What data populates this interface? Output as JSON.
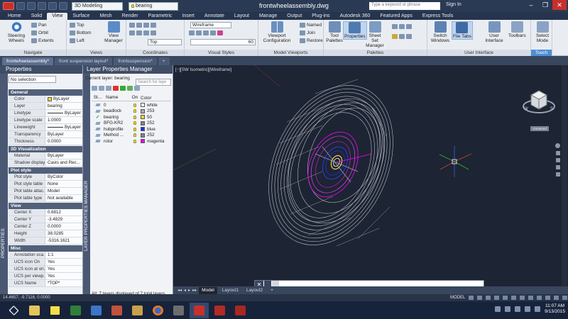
{
  "titlebar": {
    "workspace": "3D Modeling",
    "layer_current": "bearing",
    "document_title": "frontwheelassembly.dwg",
    "search_placeholder": "Type a keyword or phrase",
    "signin": "Sign In"
  },
  "ribbon_tabs": [
    "Home",
    "Solid",
    "View",
    "Surface",
    "Mesh",
    "Render",
    "Parametric",
    "Insert",
    "Annotate",
    "Layout",
    "Manage",
    "Output",
    "Plug-ins",
    "Autodesk 360",
    "Featured Apps",
    "Express Tools"
  ],
  "ribbon_active_tab": "View",
  "ribbon": {
    "navigate": {
      "label": "Navigate",
      "steering": "Steering Wheels",
      "pan": "Pan",
      "orbit": "Orbit",
      "extents": "Extents"
    },
    "views": {
      "label": "Views",
      "top": "Top",
      "bottom": "Bottom",
      "left": "Left",
      "manager": "View Manager"
    },
    "coordinates": {
      "label": "Coordinates",
      "ucs_view": "Top"
    },
    "visual_styles": {
      "label": "Visual Styles",
      "style": "Wireframe",
      "value": "60"
    },
    "model_viewports": {
      "label": "Model Viewports",
      "config": "Viewport Configuration",
      "named": "Named",
      "join": "Join",
      "restore": "Restore"
    },
    "palettes": {
      "label": "Palettes",
      "tool": "Tool Palettes",
      "properties": "Properties",
      "sheetset": "Sheet Set Manager"
    },
    "ui": {
      "label": "User Interface",
      "switch": "Switch Windows",
      "filetabs": "File Tabs",
      "userif": "User Interface",
      "toolbars": "Toolbars"
    },
    "touch": {
      "label": "Touch",
      "select": "Select Mode"
    }
  },
  "doc_tabs": [
    "frontwheelassembly*",
    "front suspension layout*",
    "frontsuspension*"
  ],
  "properties": {
    "title": "Properties",
    "selection": "No selection",
    "strip_label": "PROPERTIES",
    "sections": [
      {
        "name": "General",
        "rows": [
          {
            "k": "Color",
            "v": "ByLayer"
          },
          {
            "k": "Layer",
            "v": "bearing"
          },
          {
            "k": "Linetype",
            "v": "ByLayer"
          },
          {
            "k": "Linetype scale",
            "v": "1.0000"
          },
          {
            "k": "Lineweight",
            "v": "ByLayer"
          },
          {
            "k": "Transparency",
            "v": "ByLayer"
          },
          {
            "k": "Thickness",
            "v": "0.0000"
          }
        ]
      },
      {
        "name": "3D Visualization",
        "rows": [
          {
            "k": "Material",
            "v": "ByLayer"
          },
          {
            "k": "Shadow display",
            "v": "Casts and Rec..."
          }
        ]
      },
      {
        "name": "Plot style",
        "rows": [
          {
            "k": "Plot style",
            "v": "ByColor"
          },
          {
            "k": "Plot style table",
            "v": "None"
          },
          {
            "k": "Plot table attac...",
            "v": "Model"
          },
          {
            "k": "Plot table type",
            "v": "Not available"
          }
        ]
      },
      {
        "name": "View",
        "rows": [
          {
            "k": "Center X",
            "v": "0.6812"
          },
          {
            "k": "Center Y",
            "v": "-3.4829"
          },
          {
            "k": "Center Z",
            "v": "0.0000"
          },
          {
            "k": "Height",
            "v": "38.0285"
          },
          {
            "k": "Width",
            "v": "-5316.1621"
          }
        ]
      },
      {
        "name": "Misc",
        "rows": [
          {
            "k": "Annotation sca...",
            "v": "1:1"
          },
          {
            "k": "UCS icon On",
            "v": "Yes"
          },
          {
            "k": "UCS icon at ori...",
            "v": "Yes"
          },
          {
            "k": "UCS per viewp...",
            "v": "Yes"
          },
          {
            "k": "UCS Name",
            "v": "*TOP*"
          }
        ]
      }
    ]
  },
  "layers": {
    "title": "Layer Properties Manager",
    "current": "Current layer: bearing",
    "search_placeholder": "Search for laye",
    "strip_label": "LAYER PROPERTIES MANAGER",
    "columns": [
      "St...",
      "Name",
      "On",
      "Color"
    ],
    "rows": [
      {
        "name": "0",
        "color_name": "white",
        "color": "#ffffff",
        "current": false
      },
      {
        "name": "beadlock",
        "color_name": "253",
        "color": "#adadad",
        "current": false
      },
      {
        "name": "bearing",
        "color_name": "50",
        "color": "#ffd23c",
        "current": true
      },
      {
        "name": "BFG-KR2",
        "color_name": "252",
        "color": "#848484",
        "current": false
      },
      {
        "name": "hubprofile",
        "color_name": "blue",
        "color": "#1a2cff",
        "current": false
      },
      {
        "name": "Method ...",
        "color_name": "252",
        "color": "#848484",
        "current": false
      },
      {
        "name": "rotor",
        "color_name": "magenta",
        "color": "#ff00ff",
        "current": false
      }
    ],
    "status": "All: 7 layers displayed of 7 total layers"
  },
  "viewport": {
    "label": "[−][SW Isometric][Wireframe]",
    "viewcube_label": "Unnamed"
  },
  "command": {
    "placeholder": ""
  },
  "layout_tabs": [
    "Model",
    "Layout1",
    "Layout2"
  ],
  "status": {
    "coords": "14.4657, -9.7116, 0.0000",
    "space": "MODEL"
  },
  "taskbar": {
    "time": "11:07 AM",
    "date": "9/13/2015"
  }
}
